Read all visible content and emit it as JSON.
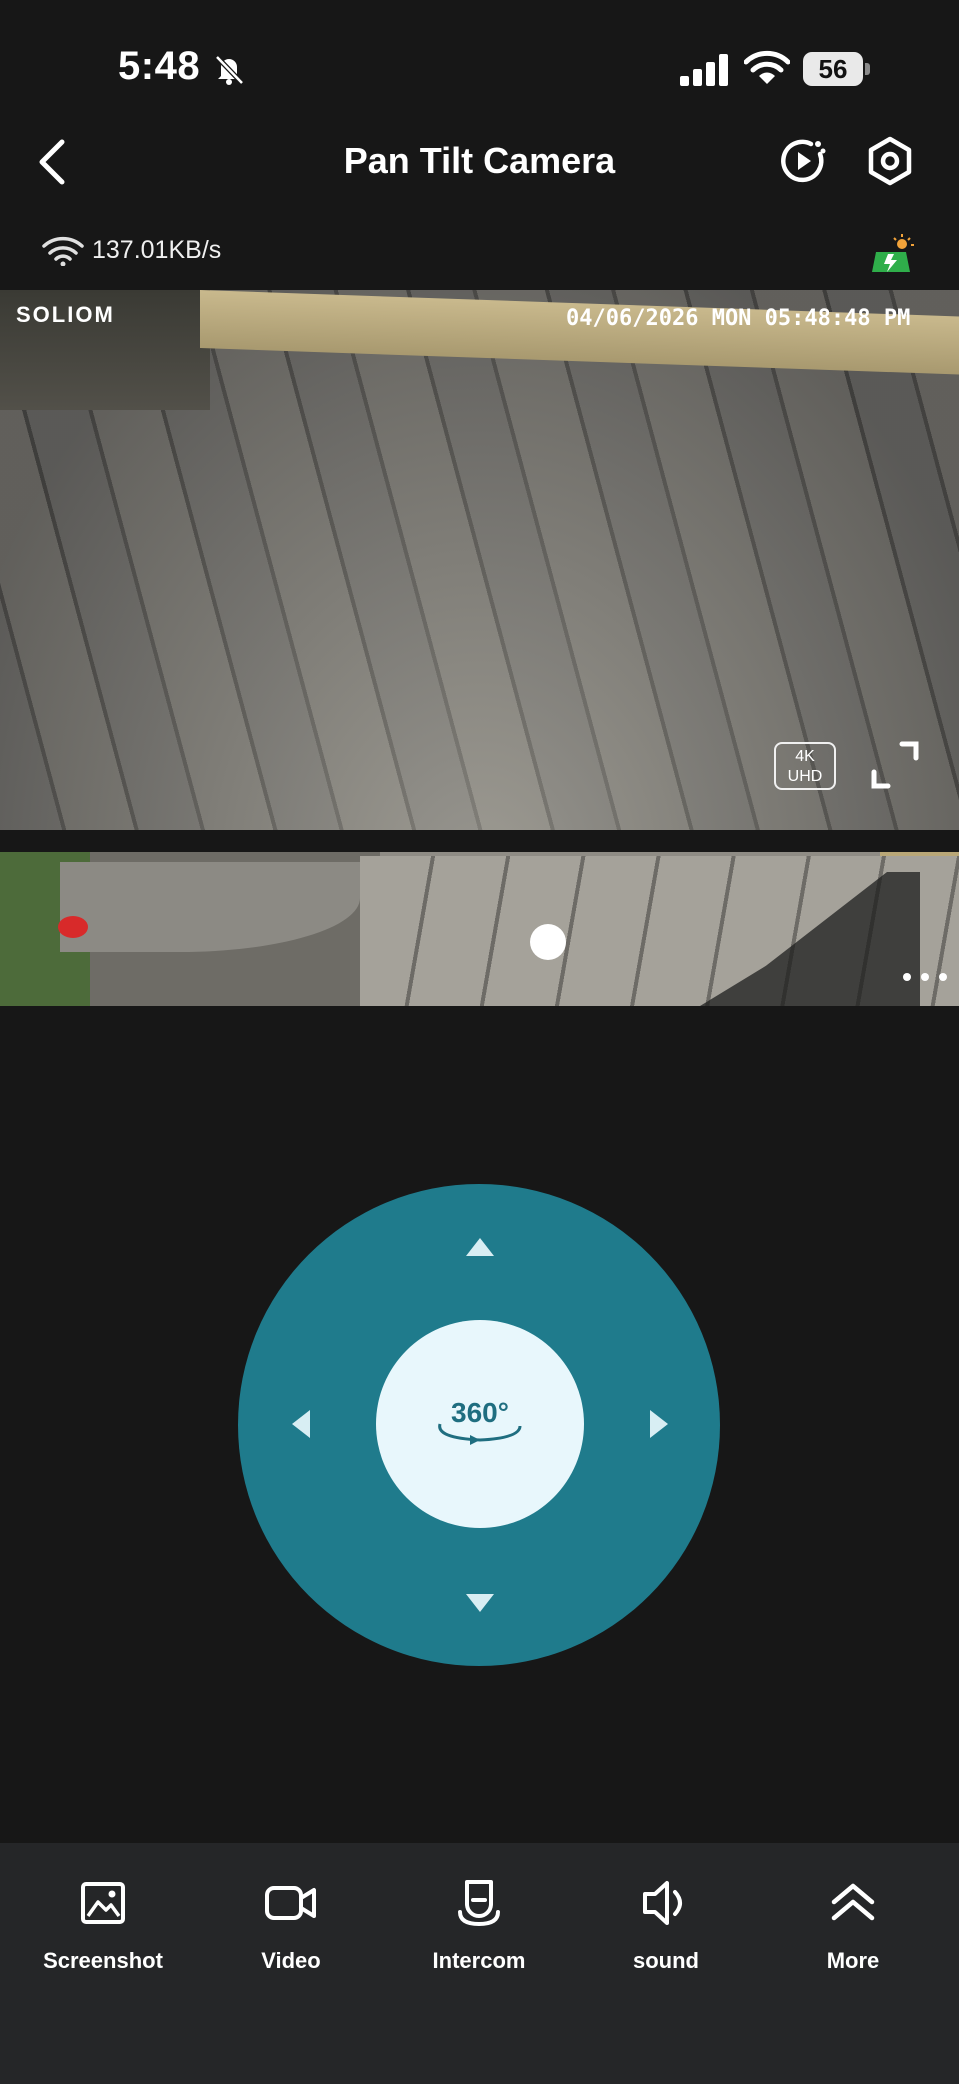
{
  "status_bar": {
    "time": "5:48",
    "battery": "56"
  },
  "header": {
    "title": "Pan Tilt Camera"
  },
  "network": {
    "rate": "137.01KB/s"
  },
  "video": {
    "brand": "SOLIOM",
    "timestamp": "04/06/2026 MON 05:48:48 PM",
    "quality_line1": "4K",
    "quality_line2": "UHD"
  },
  "ptz": {
    "center_label": "360°"
  },
  "toolbar": {
    "items": [
      {
        "label": "Screenshot",
        "icon": "image-icon"
      },
      {
        "label": "Video",
        "icon": "video-camera-icon"
      },
      {
        "label": "Intercom",
        "icon": "intercom-icon"
      },
      {
        "label": "sound",
        "icon": "speaker-icon"
      },
      {
        "label": "More",
        "icon": "double-chevron-up-icon"
      }
    ]
  },
  "colors": {
    "background": "#171717",
    "ptz_ring": "#1f7b8c",
    "ptz_center": "#e8f7fc",
    "bottom_bar": "#252628"
  }
}
